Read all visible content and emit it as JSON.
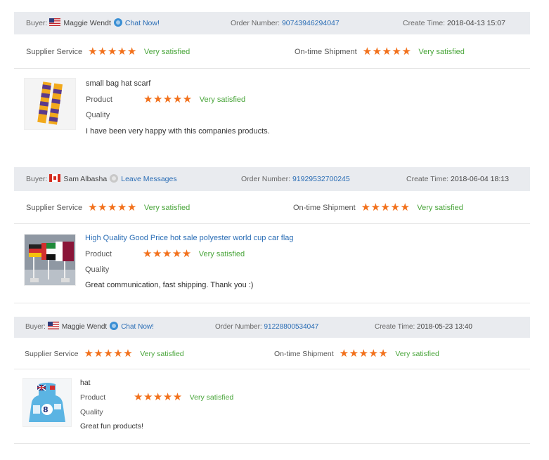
{
  "reviews": [
    {
      "buyer_label": "Buyer:",
      "flag": "us-flag-icon",
      "buyer_name": "Maggie Wendt",
      "contact_label": "Chat Now!",
      "order_label": "Order Number:",
      "order_number": "90743946294047",
      "create_label": "Create Time:",
      "create_time": "2018-04-13 15:07",
      "supplier_label": "Supplier Service",
      "supplier_stars": 5,
      "supplier_text": "Very satisfied",
      "shipment_label": "On-time Shipment",
      "shipment_stars": 5,
      "shipment_text": "Very satisfied",
      "product_title": "small bag hat scarf",
      "product_label": "Product",
      "product_stars": 5,
      "product_text": "Very satisfied",
      "quality_label": "Quality",
      "comment": "I have been very happy with this companies products."
    },
    {
      "buyer_label": "Buyer:",
      "flag": "canada-flag-icon",
      "buyer_name": "Sam Albasha",
      "contact_label": "Leave Messages",
      "order_label": "Order Number:",
      "order_number": "91929532700245",
      "create_label": "Create Time:",
      "create_time": "2018-06-04 18:13",
      "supplier_label": "Supplier Service",
      "supplier_stars": 5,
      "supplier_text": "Very satisfied",
      "shipment_label": "On-time Shipment",
      "shipment_stars": 5,
      "shipment_text": "Very satisfied",
      "product_title": "High Quality Good Price hot sale polyester world cup car flag",
      "product_label": "Product",
      "product_stars": 5,
      "product_text": "Very satisfied",
      "quality_label": "Quality",
      "comment": "Great communication, fast shipping. Thank you :)"
    },
    {
      "buyer_label": "Buyer:",
      "flag": "us-flag-icon",
      "buyer_name": "Maggie Wendt",
      "contact_label": "Chat Now!",
      "order_label": "Order Number:",
      "order_number": "91228800534047",
      "create_label": "Create Time:",
      "create_time": "2018-05-23 13:40",
      "supplier_label": "Supplier Service",
      "supplier_stars": 5,
      "supplier_text": "Very satisfied",
      "shipment_label": "On-time Shipment",
      "shipment_stars": 5,
      "shipment_text": "Very satisfied",
      "product_title": "hat",
      "product_label": "Product",
      "product_stars": 5,
      "product_text": "Very satisfied",
      "quality_label": "Quality",
      "comment": "Great fun products!"
    }
  ],
  "colors": {
    "header_bg": "#e9ebef",
    "star": "#f2711c",
    "satisfied": "#49a53a",
    "link": "#2a6db5"
  }
}
